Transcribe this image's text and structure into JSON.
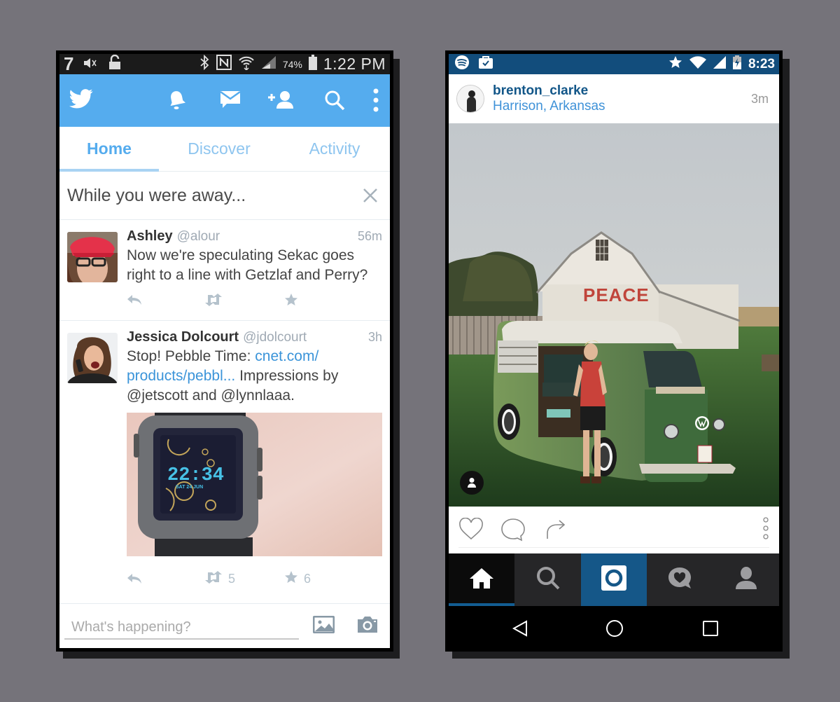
{
  "twitter": {
    "status_bar": {
      "notification_count": "7",
      "battery_percent": "74%",
      "time": "1:22 PM",
      "icons": [
        "mute-icon",
        "lock-icon",
        "bluetooth-icon",
        "nfc-icon",
        "wifi-icon",
        "signal-icon",
        "battery-icon"
      ]
    },
    "app_bar": {
      "logo": "twitter-bird-icon",
      "actions": [
        "notifications-bell-icon",
        "messages-icon",
        "add-user-icon",
        "search-icon",
        "overflow-menu-icon"
      ]
    },
    "tabs": [
      {
        "label": "Home",
        "active": true
      },
      {
        "label": "Discover",
        "active": false
      },
      {
        "label": "Activity",
        "active": false
      }
    ],
    "while_away": {
      "title": "While you were away...",
      "close_icon": "close-icon"
    },
    "tweets": [
      {
        "name": "Ashley",
        "handle": "@alour",
        "time": "56m",
        "text": "Now we're speculating Sekac goes right to a line with Getzlaf and Perry?",
        "retweets": "",
        "favorites": ""
      },
      {
        "name": "Jessica Dolcourt",
        "handle": "@jdolcourt",
        "time": "3h",
        "text_before_link": "Stop! Pebble Time:  ",
        "link_line1": "cnet.com/",
        "link_line2": "products/pebbl...",
        "text_after_link": " Impressions by @jetscott and @lynnlaaa.",
        "image": {
          "watch_time": "22:34",
          "watch_date": "SAT 24 JUN"
        },
        "retweets": "5",
        "favorites": "6"
      }
    ],
    "compose": {
      "placeholder": "What's happening?",
      "icons": [
        "image-icon",
        "camera-icon"
      ]
    }
  },
  "instagram": {
    "status_bar": {
      "time": "8:23",
      "icons": [
        "spotify-icon",
        "briefcase-check-icon",
        "star-icon",
        "wifi-icon",
        "signal-icon",
        "battery-charging-icon"
      ]
    },
    "post": {
      "username": "brenton_clarke",
      "location": "Harrison, Arkansas",
      "time": "3m",
      "photo": {
        "barn_sign": "PEACE"
      },
      "actions": [
        "like-heart-icon",
        "comment-icon",
        "share-icon",
        "more-options-icon"
      ]
    },
    "bottom_nav": [
      {
        "name": "home",
        "active": true
      },
      {
        "name": "search",
        "active": false
      },
      {
        "name": "camera",
        "active": false
      },
      {
        "name": "activity",
        "active": false
      },
      {
        "name": "profile",
        "active": false
      }
    ],
    "system_nav": [
      "back-icon",
      "home-circle-icon",
      "recents-icon"
    ]
  },
  "colors": {
    "twitter_blue": "#55acee",
    "twitter_link": "#3b94d9",
    "instagram_dark_blue": "#124d7c",
    "instagram_username": "#125688",
    "instagram_location": "#3f92d8",
    "background": "#75737a"
  }
}
